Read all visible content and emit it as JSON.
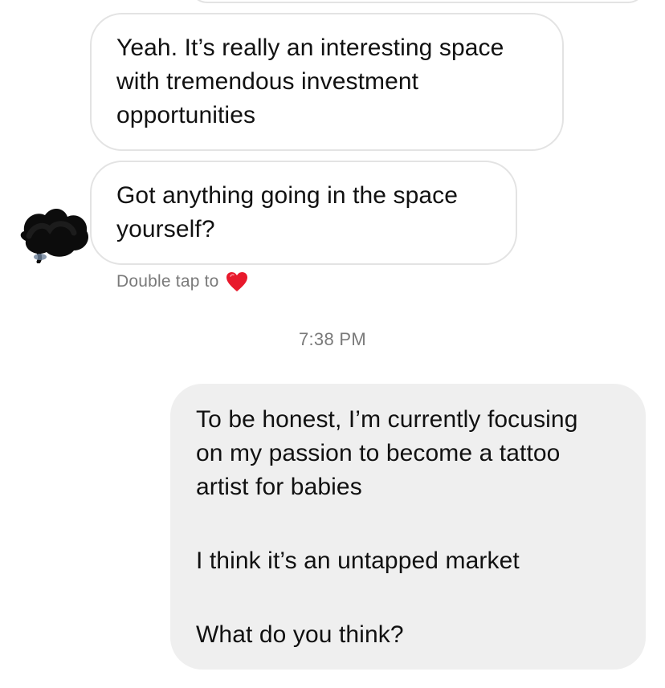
{
  "conversation": {
    "messages": [
      {
        "direction": "incoming",
        "lines": [
          "Yeah. It’s really an interesting space",
          "with tremendous investment",
          "opportunities"
        ]
      },
      {
        "direction": "incoming",
        "lines": [
          "Got anything going in the space",
          "yourself?"
        ]
      },
      {
        "direction": "outgoing",
        "paragraphs": [
          [
            "To be honest, I’m currently focusing",
            "on my passion to become a tattoo",
            "artist for babies"
          ],
          [
            "I think it’s an untapped market"
          ],
          [
            "What do you think?"
          ]
        ]
      }
    ],
    "reaction_hint": "Double tap to",
    "reaction_icon": "heart-icon",
    "timestamp": "7:38 PM"
  },
  "colors": {
    "incoming_bubble_border": "#e3e3e3",
    "outgoing_bubble_bg": "#efefef",
    "meta_text": "#7a7a7a",
    "heart": "#e8192c"
  }
}
